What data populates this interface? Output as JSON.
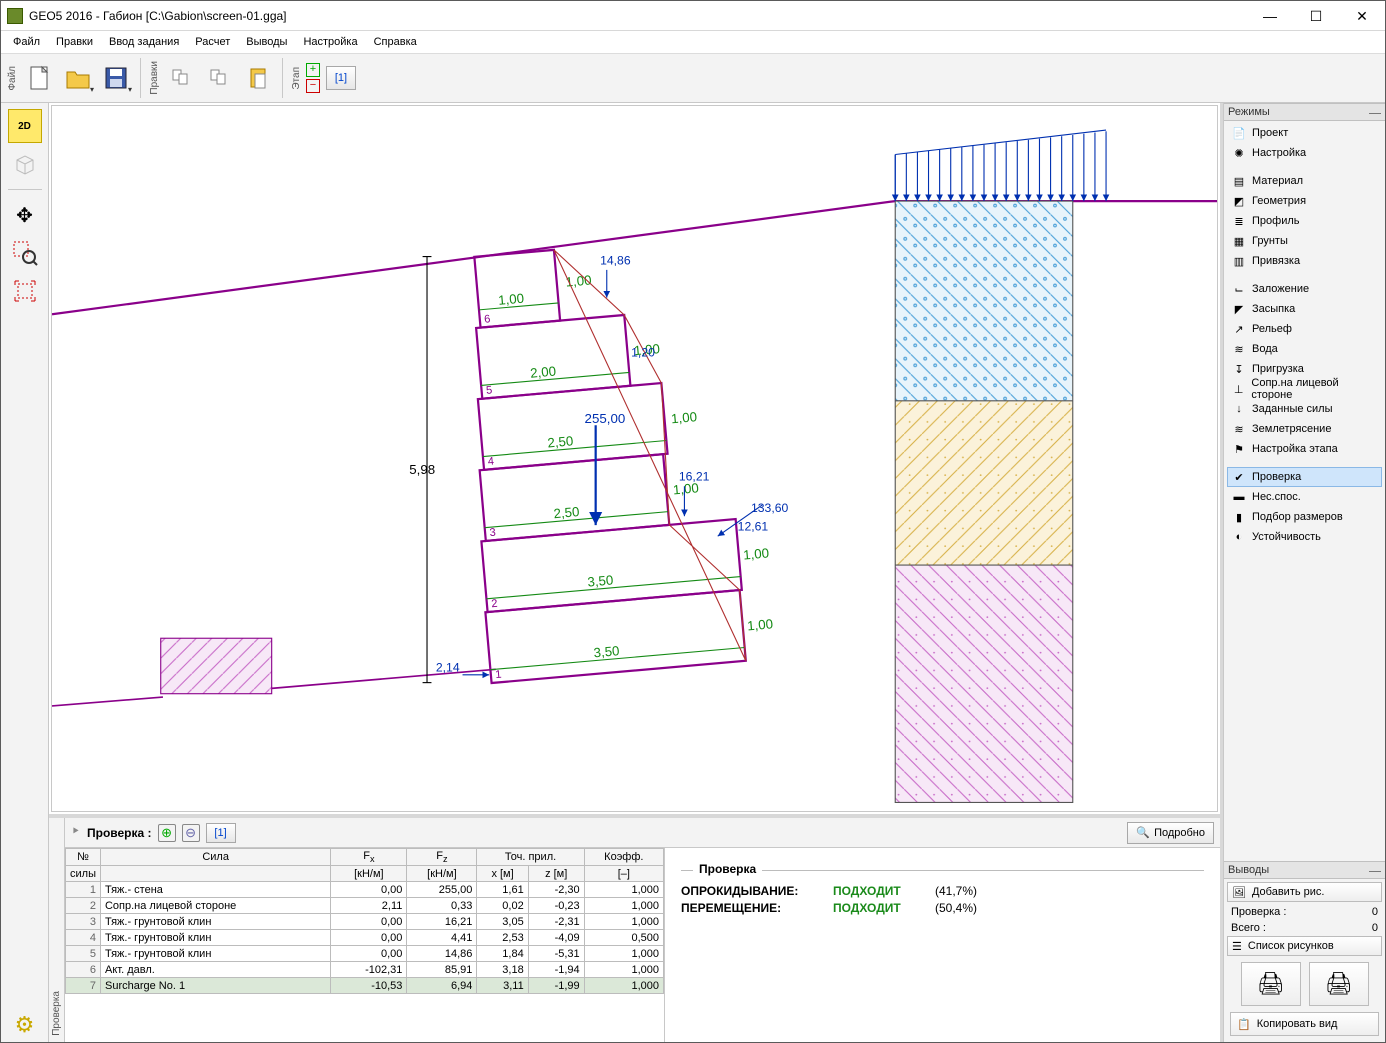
{
  "title": "GEO5 2016 - Габион [C:\\Gabion\\screen-01.gga]",
  "menu": {
    "file": "Файл",
    "edit": "Правки",
    "input": "Ввод задания",
    "calc": "Расчет",
    "out": "Выводы",
    "settings": "Настройка",
    "help": "Справка"
  },
  "toolbar": {
    "stage": "[1]",
    "vlab_file": "Файл",
    "vlab_edit": "Правки",
    "vlab_stage": "Этап"
  },
  "left": {
    "v2d": "2D",
    "v3d": "3D"
  },
  "modes_header": "Режимы",
  "modes": [
    {
      "label": "Проект",
      "icon": "📄"
    },
    {
      "label": "Настройка",
      "icon": "✺"
    },
    {
      "gap": true
    },
    {
      "label": "Материал",
      "icon": "▤"
    },
    {
      "label": "Геометрия",
      "icon": "◩"
    },
    {
      "label": "Профиль",
      "icon": "≣"
    },
    {
      "label": "Грунты",
      "icon": "▦"
    },
    {
      "label": "Привязка",
      "icon": "▥"
    },
    {
      "gap": true
    },
    {
      "label": "Заложение",
      "icon": "⌙"
    },
    {
      "label": "Засыпка",
      "icon": "◤"
    },
    {
      "label": "Рельеф",
      "icon": "↗"
    },
    {
      "label": "Вода",
      "icon": "≋"
    },
    {
      "label": "Пригрузка",
      "icon": "↧"
    },
    {
      "label": "Сопр.на лицевой стороне",
      "icon": "⊥"
    },
    {
      "label": "Заданные силы",
      "icon": "↓"
    },
    {
      "label": "Землетрясение",
      "icon": "≋"
    },
    {
      "label": "Настройка этапа",
      "icon": "⚑"
    },
    {
      "gap": true
    },
    {
      "label": "Проверка",
      "icon": "✔",
      "active": true
    },
    {
      "label": "Нес.спос.",
      "icon": "▬"
    },
    {
      "label": "Подбор размеров",
      "icon": "▮"
    },
    {
      "label": "Устойчивость",
      "icon": "◐"
    }
  ],
  "outputs_header": "Выводы",
  "outputs": {
    "add_pic": "Добавить рис.",
    "check_label": "Проверка :",
    "check_val": "0",
    "total_label": "Всего :",
    "total_val": "0",
    "list_pics": "Список рисунков",
    "copy_view": "Копировать вид"
  },
  "bottom": {
    "vlabel": "Проверка",
    "header_label": "Проверка :",
    "header_num": "[1]",
    "detail": "Подробно"
  },
  "table": {
    "headers": {
      "num1": "№",
      "num2": "силы",
      "force": "Сила",
      "fx1": "F",
      "fx_sub": "x",
      "fx2": "[кН/м]",
      "fz1": "F",
      "fz_sub": "z",
      "fz2": "[кН/м]",
      "pt1": "Точ. прил.",
      "x2": "x [м]",
      "z2": "z [м]",
      "k1": "Коэфф.",
      "k2": "[–]"
    },
    "rows": [
      {
        "n": "1",
        "name": "Тяж.- стена",
        "fx": "0,00",
        "fz": "255,00",
        "x": "1,61",
        "z": "-2,30",
        "k": "1,000"
      },
      {
        "n": "2",
        "name": "Сопр.на лицевой стороне",
        "fx": "2,11",
        "fz": "0,33",
        "x": "0,02",
        "z": "-0,23",
        "k": "1,000"
      },
      {
        "n": "3",
        "name": "Тяж.- грунтовой клин",
        "fx": "0,00",
        "fz": "16,21",
        "x": "3,05",
        "z": "-2,31",
        "k": "1,000"
      },
      {
        "n": "4",
        "name": "Тяж.- грунтовой клин",
        "fx": "0,00",
        "fz": "4,41",
        "x": "2,53",
        "z": "-4,09",
        "k": "0,500"
      },
      {
        "n": "5",
        "name": "Тяж.- грунтовой клин",
        "fx": "0,00",
        "fz": "14,86",
        "x": "1,84",
        "z": "-5,31",
        "k": "1,000"
      },
      {
        "n": "6",
        "name": "Акт. давл.",
        "fx": "-102,31",
        "fz": "85,91",
        "x": "3,18",
        "z": "-1,94",
        "k": "1,000"
      },
      {
        "n": "7",
        "name": "Surcharge No. 1",
        "fx": "-10,53",
        "fz": "6,94",
        "x": "3,11",
        "z": "-1,99",
        "k": "1,000",
        "sel": true
      }
    ]
  },
  "result": {
    "group": "Проверка",
    "overturn_k": "ОПРОКИДЫВАНИЕ:",
    "overturn_v": "ПОДХОДИТ",
    "overturn_p": "(41,7%)",
    "shift_k": "ПЕРЕМЕЩЕНИЕ:",
    "shift_v": "ПОДХОДИТ",
    "shift_p": "(50,4%)"
  },
  "drawing": {
    "height_label": "5,98",
    "blocks_w": [
      "3,50",
      "3,50",
      "2,50",
      "2,50",
      "2,00",
      "1,00"
    ],
    "blocks_h": [
      "1,00",
      "1,00",
      "1,00",
      "1,00",
      "1,00",
      "1,00"
    ],
    "block_ids": [
      "1",
      "2",
      "3",
      "4",
      "5",
      "6"
    ],
    "mainforce": "255,00",
    "xecc": "2,14",
    "f1": "14,86",
    "f2": "1,20",
    "f3": "16,21",
    "f4": "12,61",
    "f5": "133,60"
  }
}
